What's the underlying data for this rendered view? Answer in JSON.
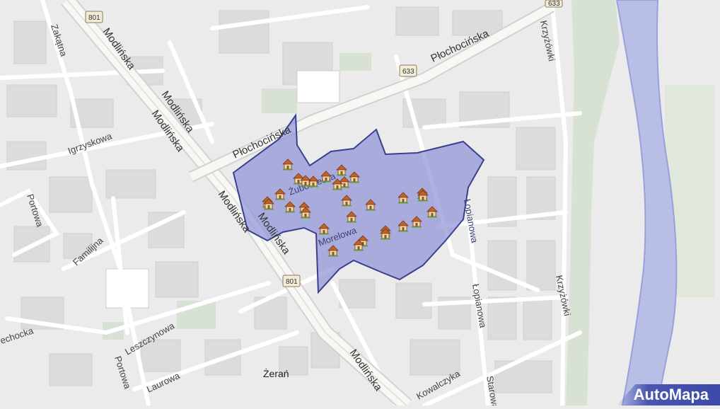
{
  "streets": {
    "modlinska_1": "Modlińska",
    "modlinska_2": "Modlińska",
    "modlinska_3": "Modlińska",
    "modlinska_4": "Modlińska",
    "modlinska_5": "Modlińska",
    "modlinska_6": "Modlińska",
    "plochocinska_1": "Płochocińska",
    "plochocinska_2": "Płochocińska",
    "krzyzowki_1": "Krzyżówki",
    "krzyzowki_2": "Krzyżówki",
    "zakatna": "Zakątna",
    "igrzyskowa": "Igrzyskowa",
    "portowa_1": "Portowa",
    "portowa_2": "Portowa",
    "familijna": "Familijna",
    "zubowiecka": "Żubowiecka",
    "morelowa": "Morelowa",
    "lopianowa_1": "Łopianowa",
    "lopianowa_2": "Łopianowa",
    "leszczynowa": "Leszczynowa",
    "laurowa": "Laurowa",
    "kowalczyka": "Kowalczyka",
    "starowa": "Starowa",
    "echocka": "echocka"
  },
  "road_badges": {
    "r801_a": "801",
    "r801_b": "801",
    "r633_a": "633",
    "r633_b": "633"
  },
  "places": {
    "zeran": "Żerań"
  },
  "brand": {
    "label": "AutoMapa"
  },
  "colors": {
    "background": "#ebebeb",
    "road": "#ffffff",
    "building": "#dcdcdc",
    "park": "#d7e2d3",
    "river": "#b9bee6",
    "area_fill": "#8c90d6",
    "area_stroke": "#3a3f8f"
  },
  "markers": {
    "icon": "house-icon",
    "count": 30
  }
}
